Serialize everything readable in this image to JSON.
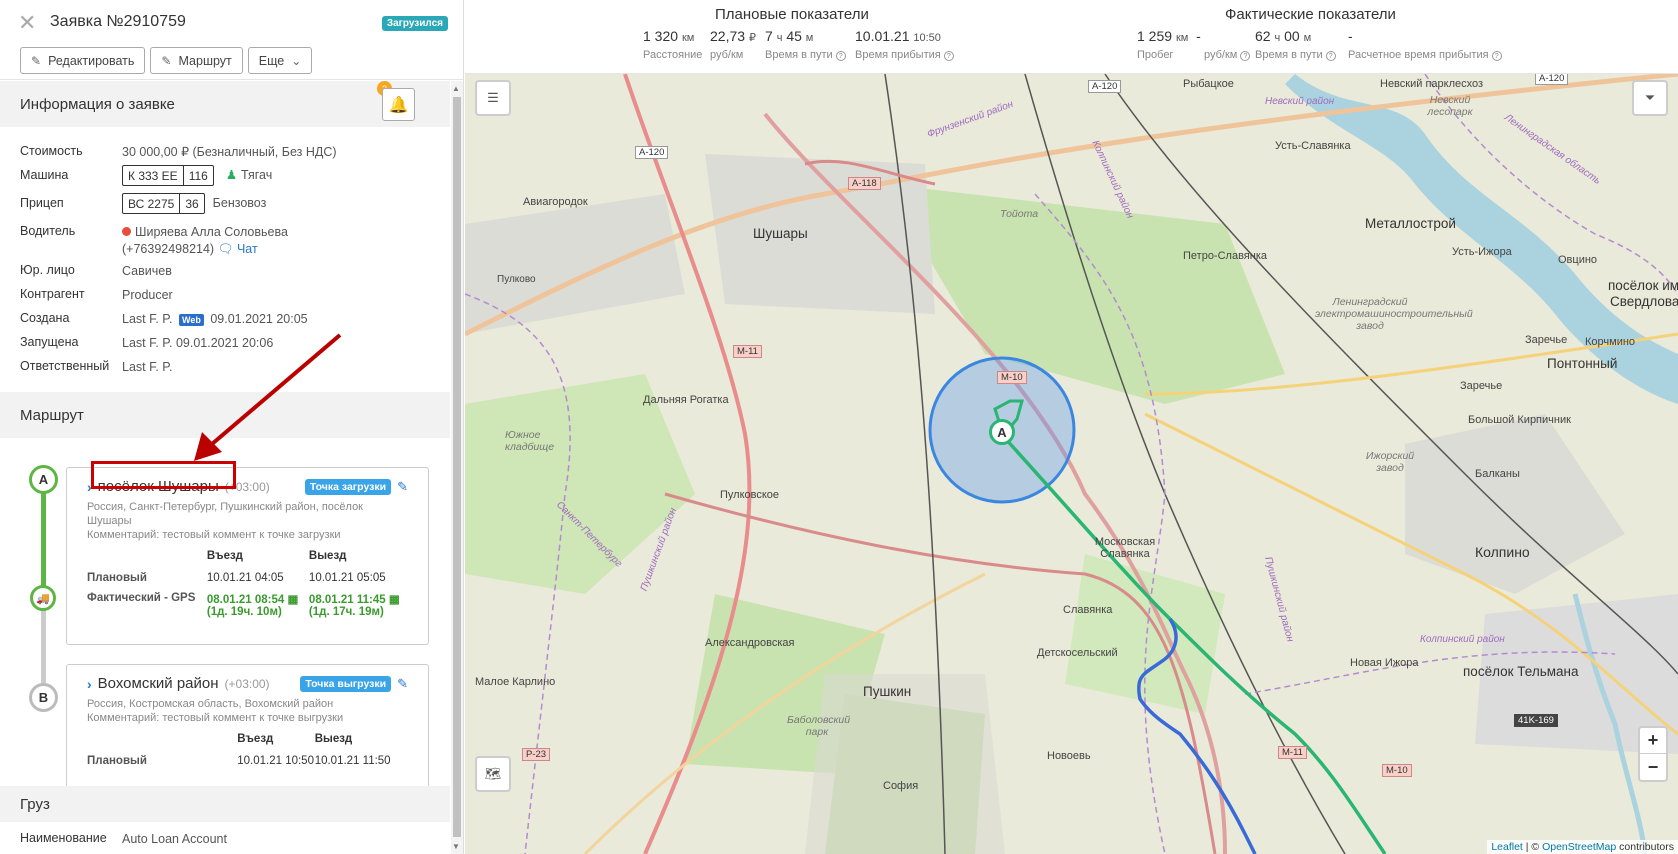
{
  "header": {
    "order_title": "Заявка №2910759",
    "status": "Загрузился",
    "buttons": {
      "edit": "Редактировать",
      "route": "Маршрут",
      "more": "Еще"
    }
  },
  "info_section": {
    "title": "Информация о заявке",
    "notifications_count": "3",
    "rows": {
      "cost_label": "Стоимость",
      "cost_value": "30 000,00 ₽ (Безналичный, Без НДС)",
      "vehicle_label": "Машина",
      "vehicle_plate": "К 333 ЕЕ",
      "vehicle_region": "116",
      "vehicle_type": "Тягач",
      "trailer_label": "Прицеп",
      "trailer_plate": "ВС 2275",
      "trailer_region": "36",
      "trailer_type": "Бензовоз",
      "driver_label": "Водитель",
      "driver_name": "Ширяева Алла Соловьева",
      "driver_phone": "(+76392498214)",
      "chat": "Чат",
      "legal_label": "Юр. лицо",
      "legal_value": "Савичев",
      "contractor_label": "Контрагент",
      "contractor_value": "Producer",
      "created_label": "Создана",
      "created_by": "Last F. P.",
      "created_web": "Web",
      "created_at": "09.01.2021 20:05",
      "started_label": "Запущена",
      "started_value": "Last F. P. 09.01.2021 20:06",
      "responsible_label": "Ответственный",
      "responsible_value": "Last F. P."
    }
  },
  "route_section": {
    "title": "Маршрут",
    "points": [
      {
        "letter": "A",
        "name": "посёлок Шушары",
        "tz": "(+03:00)",
        "tag": "Точка загрузки",
        "address": "Россия, Санкт-Петербург, Пушкинский район, посёлок Шушары",
        "comment": "Комментарий: тестовый коммент к точке загрузки",
        "col_in": "Въезд",
        "col_out": "Выезд",
        "plan_label": "Плановый",
        "plan_in": "10.01.21 04:05",
        "plan_out": "10.01.21 05:05",
        "fact_label": "Фактический - GPS",
        "fact_in": "08.01.21 08:54",
        "fact_in_delta": "(1д. 19ч. 10м)",
        "fact_out": "08.01.21 11:45",
        "fact_out_delta": "(1д. 17ч. 19м)"
      },
      {
        "letter": "B",
        "name": "Вохомский район",
        "tz": "(+03:00)",
        "tag": "Точка выгрузки",
        "address": "Россия, Костромская область, Вохомский район",
        "comment": "Комментарий: тестовый коммент к точке выгрузки",
        "col_in": "Въезд",
        "col_out": "Выезд",
        "plan_label": "Плановый",
        "plan_in": "10.01.21 10:50",
        "plan_out": "10.01.21 11:50"
      }
    ]
  },
  "cargo_section": {
    "title": "Груз",
    "name_label": "Наименование",
    "name_value": "Auto Loan Account"
  },
  "stats": {
    "plan_title": "Плановые показатели",
    "fact_title": "Фактические показатели",
    "plan": {
      "distance": "1 320",
      "distance_unit": "км",
      "distance_label": "Расстояние",
      "rate": "22,73",
      "rate_unit": "₽",
      "rate_label": "руб/км",
      "time_h": "7",
      "time_m": "45",
      "time_label": "Время в пути",
      "arrival": "10.01.21",
      "arrival_time": "10:50",
      "arrival_label": "Время прибытия"
    },
    "fact": {
      "mileage": "1 259",
      "mileage_unit": "км",
      "mileage_label": "Пробег",
      "rate": "-",
      "rate_label": "руб/км",
      "time_h": "62",
      "time_m": "00",
      "time_label": "Время в пути",
      "arrival": "-",
      "arrival_label": "Расчетное время прибытия"
    },
    "h_unit": "ч",
    "m_unit": "м"
  },
  "map": {
    "labels": {
      "shushary": "Шушары",
      "aviagorodok": "Авиагородок",
      "pulkovo": "Пулково",
      "dalnyaya": "Дальняя Рогатка",
      "yuzhnoe": "Южное кладбище",
      "pulkovskoe": "Пулковское",
      "aleksandrovskaya": "Александровская",
      "malo_karlino": "Малое Карлино",
      "pushkin": "Пушкин",
      "babolovsky": "Баболовский парк",
      "sofia": "София",
      "novoe": "Новоевь",
      "slavyanka": "Славянка",
      "detskoselsky": "Детскосельский",
      "moskovskaya": "Московская Славянка",
      "petro": "Петро-Славянка",
      "rybatskoe": "Рыбацкое",
      "nevsky_park": "Невский парклесхоз",
      "nevsky_les": "Невский лесопарк",
      "ust_slavyanka": "Усть-Славянка",
      "metallostroy": "Металлострой",
      "ust_izhora": "Усть-Ижора",
      "ovtsyno": "Овцино",
      "poselok_ime": "посёлок име",
      "sverdlova": "Свердлова",
      "zarechye1": "Заречье",
      "zarechye2": "Заречье",
      "korchmino": "Корчмино",
      "pontonny": "Понтонный",
      "bolshoy": "Большой Кирпичник",
      "balkany": "Балканы",
      "kolpino": "Колпино",
      "izhorsky": "Ижорский завод",
      "novaya_izhora": "Новая Ижора",
      "telmana": "посёлок Тельмана",
      "lenzavod": "Ленинградский электромашиностроительный завод",
      "toyota": "Тойота",
      "nevsky_rayon": "Невский район",
      "frunz": "Фрунзенский район",
      "kolp_rayon": "Колпинский район",
      "lenobl": "Ленинградская область",
      "spb": "Санкт-Петербург",
      "push_rayon": "Пушкинский район",
      "push_rayon2": "Пушкинский район",
      "kolp_rayon2": "Колпинский район"
    },
    "roads": {
      "a120_1": "A-120",
      "a120_2": "A-120",
      "a120_3": "A-120",
      "a118": "A-118",
      "m11_1": "M-11",
      "m11_2": "M-11",
      "m10_1": "M-10",
      "m10_2": "M-10",
      "p23": "P-23",
      "k169": "41K-169"
    },
    "marker_letter": "A",
    "zoom_in": "+",
    "zoom_out": "−",
    "attribution_leaflet": "Leaflet",
    "attribution_sep": " | © ",
    "attribution_osm": "OpenStreetMap",
    "attribution_suffix": " contributors"
  }
}
